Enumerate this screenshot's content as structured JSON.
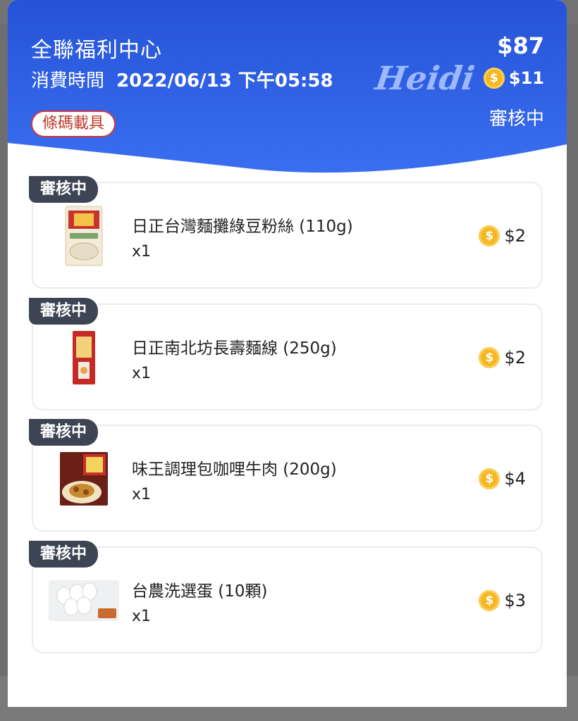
{
  "receipt": {
    "store_name": "全聯福利中心",
    "time_label": "消費時間",
    "datetime": "2022/06/13 下午05:58",
    "carrier_label": "條碼載具",
    "signature": "Heidi",
    "total": "$87",
    "coin_amount": "$11",
    "status": "審核中"
  },
  "items": [
    {
      "badge": "審核中",
      "name": "日正台灣麵攤綠豆粉絲 (110g)",
      "qty": "x1",
      "price": "$2",
      "thumb_icon": "noodle-package-icon"
    },
    {
      "badge": "審核中",
      "name": "日正南北坊長壽麵線 (250g)",
      "qty": "x1",
      "price": "$2",
      "thumb_icon": "noodle-package-icon"
    },
    {
      "badge": "審核中",
      "name": "味王調理包咖哩牛肉 (200g)",
      "qty": "x1",
      "price": "$4",
      "thumb_icon": "curry-package-icon"
    },
    {
      "badge": "審核中",
      "name": "台農洗選蛋 (10顆)",
      "qty": "x1",
      "price": "$3",
      "thumb_icon": "egg-carton-icon"
    }
  ],
  "coin_symbol": "$",
  "colors": {
    "header_blue": "#2f5fe0",
    "badge_dark": "#3d4554",
    "coin_gold": "#f6b722",
    "chip_red": "#d33a3a"
  }
}
